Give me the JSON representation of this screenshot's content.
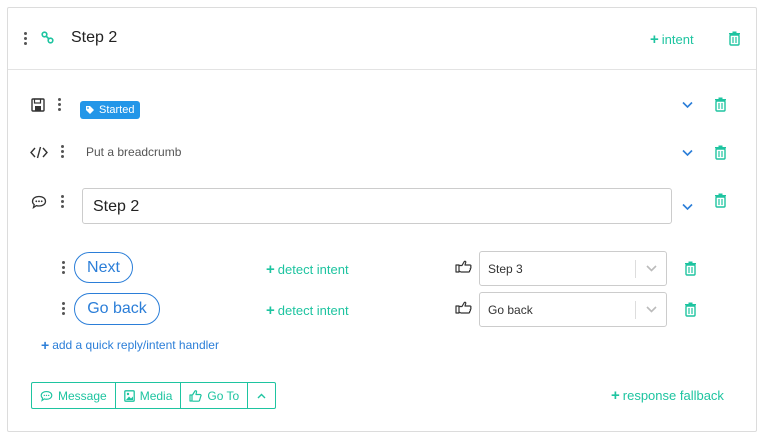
{
  "header": {
    "title": "Step 2",
    "add_intent_label": "intent"
  },
  "rows": {
    "started_badge": "Started",
    "breadcrumb_text": "Put a breadcrumb",
    "message_text": "Step 2"
  },
  "quick_replies": [
    {
      "label": "Next",
      "detect_label": "detect intent",
      "target": "Step 3"
    },
    {
      "label": "Go back",
      "detect_label": "detect intent",
      "target": "Go back"
    }
  ],
  "add_handler_label": "add a quick reply/intent handler",
  "footer": {
    "buttons": [
      {
        "label": "Message",
        "icon": "chat-bubble-icon"
      },
      {
        "label": "Media",
        "icon": "image-icon"
      },
      {
        "label": "Go To",
        "icon": "thumbs-up-icon"
      }
    ],
    "response_fallback_label": "response fallback"
  },
  "colors": {
    "accent_teal": "#1ec4a0",
    "accent_blue": "#2b7ed8",
    "badge_blue": "#2396e8"
  }
}
